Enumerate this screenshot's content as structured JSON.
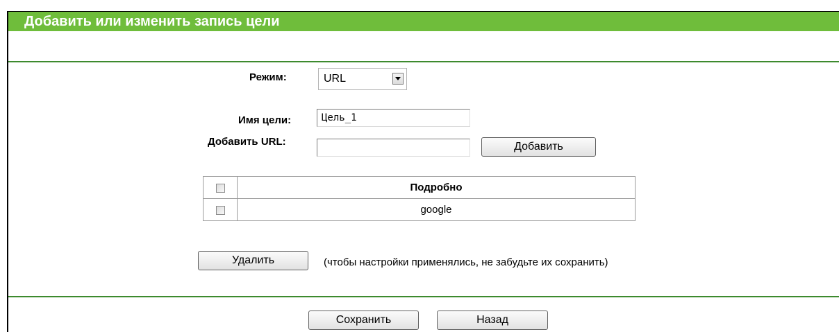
{
  "page": {
    "title": "Добавить или изменить запись цели"
  },
  "form": {
    "mode_label": "Режим:",
    "mode_value": "URL",
    "target_name_label": "Имя цели:",
    "target_name_value": "Цель_1",
    "add_url_label": "Добавить URL:",
    "add_url_value": "",
    "add_button": "Добавить"
  },
  "table": {
    "header": "Подробно",
    "rows": [
      {
        "label": "google"
      }
    ]
  },
  "actions": {
    "delete_button": "Удалить",
    "note": "(чтобы настройки применялись, не забудьте их сохранить)",
    "save_button": "Сохранить",
    "back_button": "Назад"
  },
  "colors": {
    "title_bar": "#6fbd3b",
    "rule": "#3d8a2e"
  },
  "icons": {
    "select_arrow": "chevron-down-icon"
  }
}
